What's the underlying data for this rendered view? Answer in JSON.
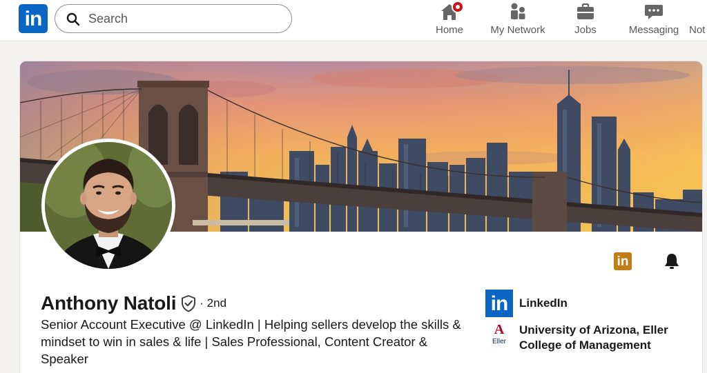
{
  "nav": {
    "logo_text": "in",
    "search_placeholder": "Search",
    "items": [
      {
        "label": "Home",
        "icon": "home-icon"
      },
      {
        "label": "My Network",
        "icon": "network-icon"
      },
      {
        "label": "Jobs",
        "icon": "briefcase-icon"
      },
      {
        "label": "Messaging",
        "icon": "messaging-icon"
      },
      {
        "label": "Not",
        "icon": "bell-icon"
      }
    ]
  },
  "profile": {
    "name": "Anthony Natoli",
    "degree": "· 2nd",
    "headline": "Senior Account Executive @ LinkedIn | Helping sellers develop the skills & mindset to win in sales & life | Sales Professional, Content Creator & Speaker",
    "actions": {
      "linkedin_icon_text": "in"
    },
    "affiliations": [
      {
        "name": "LinkedIn",
        "logo_text": "in"
      },
      {
        "name_line1": "University of Arizona, Eller",
        "name_line2": "College of Management",
        "logo_mark": "A",
        "logo_sub": "Eller"
      }
    ]
  },
  "colors": {
    "brand": "#0a66c2",
    "notification": "#cc1016",
    "premium_gold": "#c37d16",
    "ua_red": "#ab0520",
    "ua_navy": "#0c234b"
  }
}
